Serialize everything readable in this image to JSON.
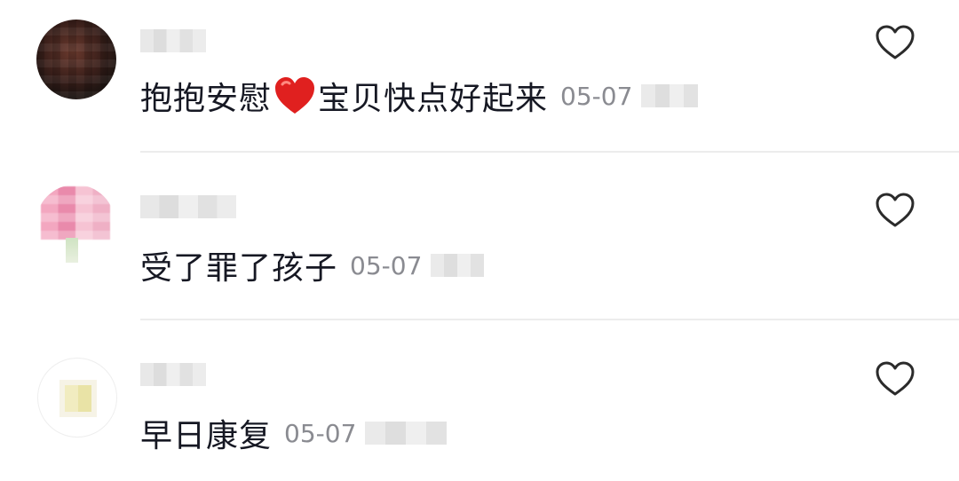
{
  "comments": [
    {
      "text_part1": "抱抱安慰",
      "emoji": "heart-emoji",
      "text_part2": "宝贝快点好起来",
      "date": "05-07"
    },
    {
      "text": "受了罪了孩子",
      "date": "05-07"
    },
    {
      "text": "早日康复",
      "date": "05-07"
    }
  ],
  "icons": {
    "like": "heart-outline-icon",
    "emoji": "red-heart-icon"
  },
  "colors": {
    "text": "#161823",
    "meta": "#8a8b91",
    "divider": "#ececec",
    "heart_emoji": "#e0201f"
  }
}
